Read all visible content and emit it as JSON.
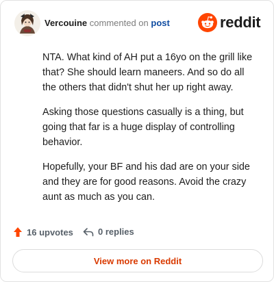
{
  "header": {
    "username": "Vercouine",
    "action": "commented on",
    "link": "post",
    "brand": "reddit"
  },
  "comment": {
    "paragraphs": [
      "NTA. What kind of AH put a 16yo on the grill like that? She should learn maneers. And so do all the others that didn't shut her up right away.",
      "Asking those questions casually is a thing, but going that far is a huge display of controlling behavior.",
      "Hopefully, your BF and his dad are on your side and they are for good reasons. Avoid the crazy aunt as much as you can."
    ]
  },
  "footer": {
    "upvotes": "16 upvotes",
    "replies": "0 replies"
  },
  "cta": {
    "label": "View more on Reddit"
  },
  "colors": {
    "brand_orange": "#ff4500",
    "link_blue": "#0f4ca1",
    "cta_text": "#d93a00"
  },
  "icons": {
    "avatar": "user-avatar",
    "logo": "reddit-logo-icon",
    "upvote": "upvote-arrow-icon",
    "reply": "reply-arrow-icon"
  }
}
